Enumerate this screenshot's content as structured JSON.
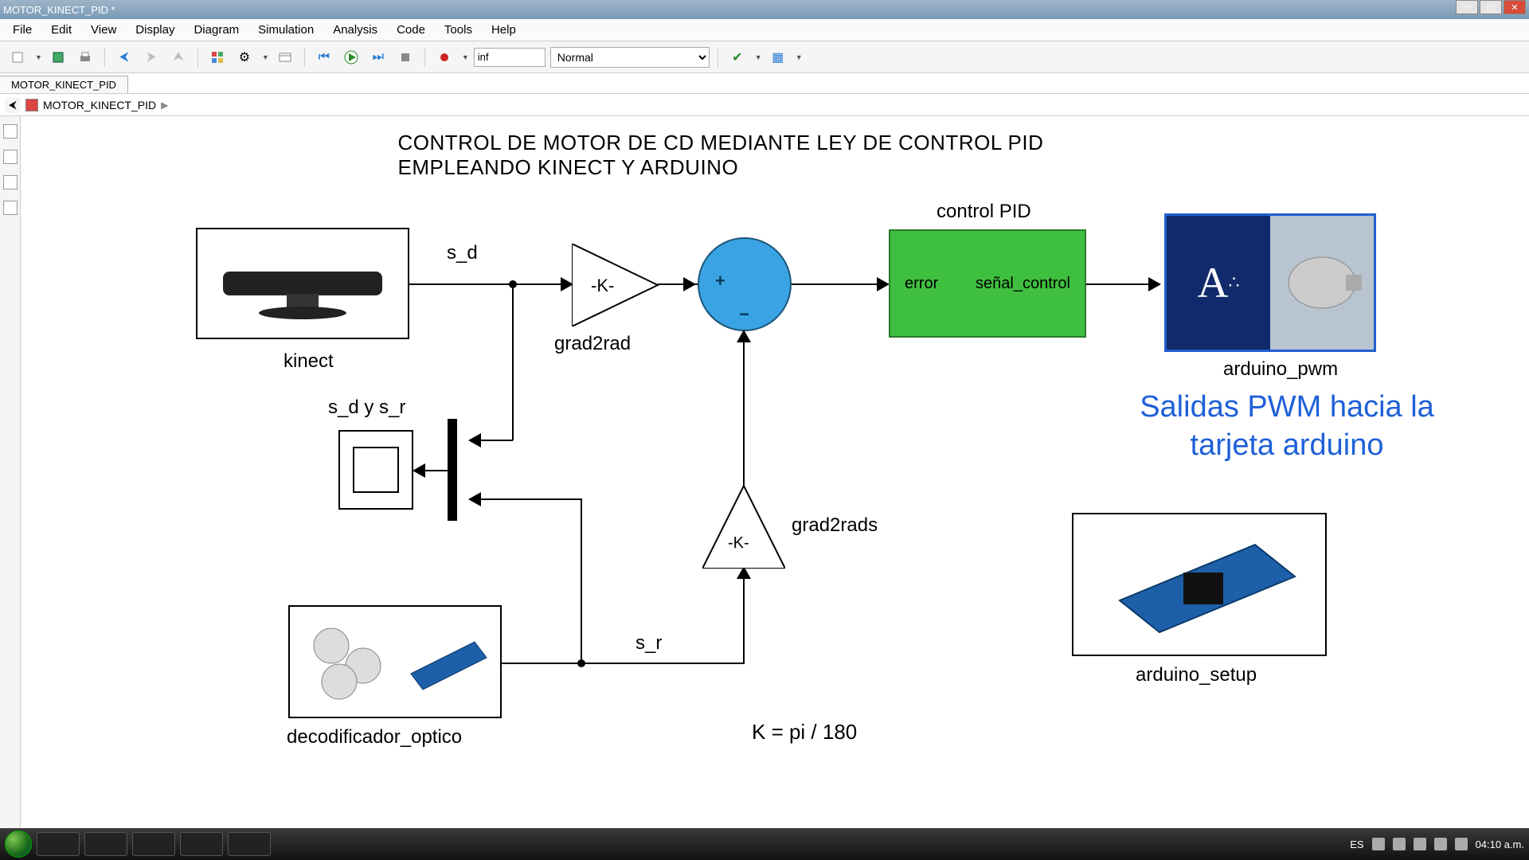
{
  "window": {
    "title": "MOTOR_KINECT_PID *"
  },
  "menu": {
    "items": [
      "File",
      "Edit",
      "View",
      "Display",
      "Diagram",
      "Simulation",
      "Analysis",
      "Code",
      "Tools",
      "Help"
    ]
  },
  "toolbar": {
    "stop_time": "inf",
    "sim_mode": "Normal"
  },
  "tabs": {
    "active": "MOTOR_KINECT_PID"
  },
  "breadcrumb": {
    "model": "MOTOR_KINECT_PID"
  },
  "diagram": {
    "title": "CONTROL DE MOTOR DE CD MEDIANTE LEY DE CONTROL PID EMPLEANDO KINECT Y ARDUINO",
    "blocks": {
      "kinect": {
        "label": "kinect"
      },
      "gain1": {
        "text": "-K-",
        "label": "grad2rad"
      },
      "sum": {
        "plus": "+",
        "minus": "−"
      },
      "pid": {
        "label_top": "control PID",
        "in": "error",
        "out": "señal_control"
      },
      "arduino_pwm": {
        "label": "arduino_pwm",
        "glyph": "A"
      },
      "annotation_pwm": "Salidas PWM hacia la\ntarjeta arduino",
      "arduino_setup": {
        "label": "arduino_setup"
      },
      "scope": {
        "label": "s_d y s_r"
      },
      "gain2": {
        "text": "-K-",
        "label": "grad2rads"
      },
      "decoder": {
        "label": "decodificador_optico"
      },
      "constant_note": "K = pi / 180"
    },
    "signals": {
      "s_d": "s_d",
      "s_r": "s_r"
    }
  },
  "taskbar": {
    "lang": "ES",
    "clock": "04:10 a.m."
  }
}
